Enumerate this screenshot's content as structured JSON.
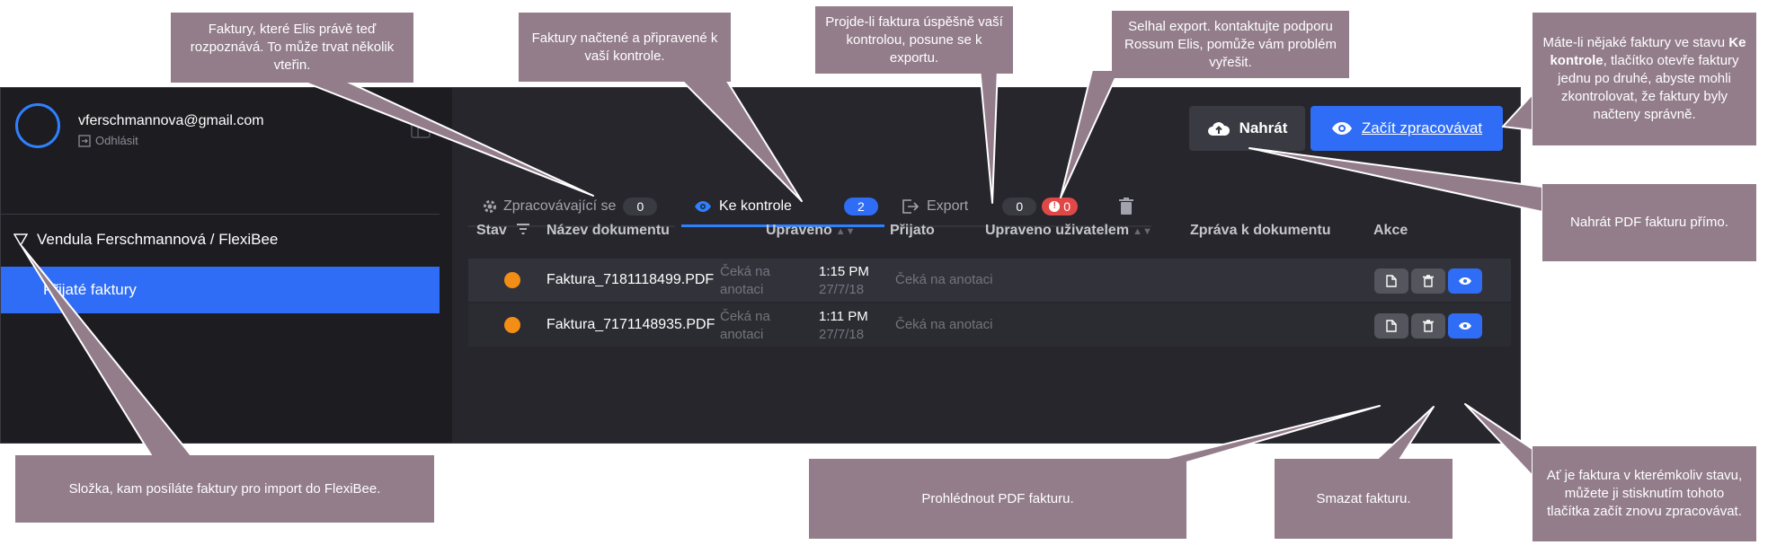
{
  "user": {
    "email": "vferschmannova@gmail.com",
    "logout_label": "Odhlásit"
  },
  "sidebar": {
    "org_label": "Vendula Ferschmannová / FlexiBee",
    "folder_label": "Přijaté faktury"
  },
  "toolbar": {
    "upload_label": "Nahrát",
    "start_label": "Začít zpracovávat"
  },
  "tabs": [
    {
      "label": "Zpracovávající se",
      "count": "0"
    },
    {
      "label": "Ke kontrole",
      "count": "2"
    },
    {
      "label": "Export",
      "count": "0",
      "error_count": "0"
    }
  ],
  "table": {
    "headers": [
      "Stav",
      "Název dokumentu",
      "Upraveno",
      "Přijato",
      "Upraveno uživatelem",
      "Zpráva k dokumentu",
      "Akce"
    ],
    "rows": [
      {
        "name": "Faktura_7181118499.PDF",
        "edited_line1": "Čeká na",
        "edited_line2": "anotaci",
        "time": "1:15 PM",
        "date": "27/7/18",
        "edited_by": "Čeká na anotaci"
      },
      {
        "name": "Faktura_7171148935.PDF",
        "edited_line1": "Čeká na",
        "edited_line2": "anotaci",
        "time": "1:11 PM",
        "date": "27/7/18",
        "edited_by": "Čeká na anotaci"
      }
    ]
  },
  "callouts": {
    "processing": "Faktury, které Elis právě teď rozpoznává. To může trvat několik vteřin.",
    "review": "Faktury načtené a připravené k vaší kontrole.",
    "export": "Projde-li faktura úspěšně vaší kontrolou, posune se k exportu.",
    "failed": "Selhal export. kontaktujte podporu Rossum Elis, pomůže vám problém vyřešit.",
    "start_prefix": "Máte-li nějaké faktury ve stavu ",
    "start_bold": "Ke kontrole",
    "start_suffix": ", tlačítko otevře faktury jednu po druhé, abyste mohli zkontrolovat, že faktury byly načteny správně.",
    "upload": "Nahrát PDF fakturu přímo.",
    "folder": "Složka, kam posíláte faktury pro import do FlexiBee.",
    "view_pdf": "Prohlédnout PDF fakturu.",
    "delete": "Smazat fakturu.",
    "reprocess": "Ať je faktura v kterémkoliv stavu, můžete ji stisknutím tohoto tlačítka začít znovu zpracovávat."
  },
  "colors": {
    "accent": "#2f6df6",
    "callout": "#937d8b",
    "status_pending": "#f28e16",
    "error": "#e04848"
  },
  "icons": [
    "user-avatar",
    "logout-icon",
    "sidebar-collapse-icon",
    "triangle-down-icon",
    "upload-cloud-icon",
    "eye-icon",
    "gear-icon",
    "export-icon",
    "error-icon",
    "trash-icon",
    "filter-icon",
    "document-icon"
  ]
}
